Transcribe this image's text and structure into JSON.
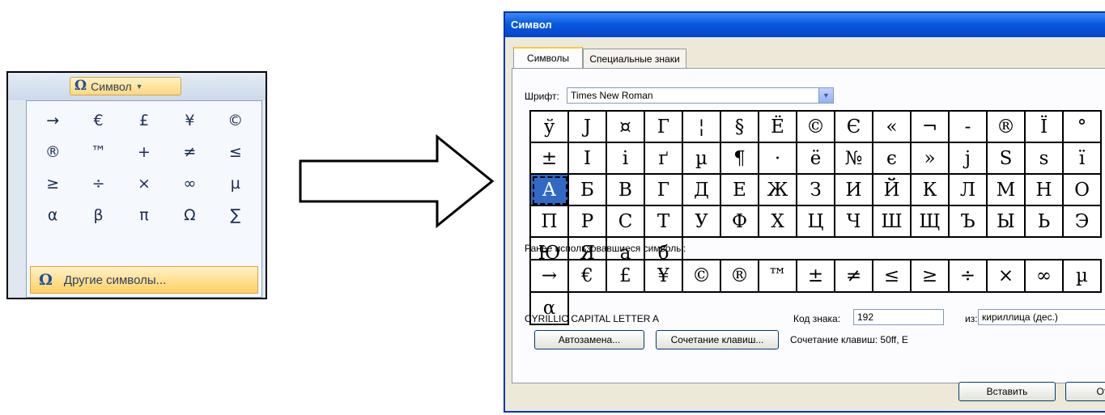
{
  "dropdown": {
    "button_label": "Символ",
    "symbols": [
      "→",
      "€",
      "£",
      "¥",
      "©",
      "®",
      "™",
      "+",
      "≠",
      "≤",
      "≥",
      "÷",
      "×",
      "∞",
      "µ",
      "α",
      "β",
      "π",
      "Ω",
      "∑"
    ],
    "other_symbols_label": "Другие символы..."
  },
  "dialog": {
    "title": "Символ",
    "tabs": [
      "Символы",
      "Специальные знаки"
    ],
    "font_label": "Шрифт:",
    "font_value": "Times New Roman",
    "grid_rows": [
      [
        "ў",
        "J",
        "¤",
        "Г",
        "¦",
        "§",
        "Ё",
        "©",
        "Є",
        "«",
        "¬",
        "-",
        "®",
        "Ї",
        "°",
        "±"
      ],
      [
        "I",
        "і",
        "ґ",
        "µ",
        "¶",
        "·",
        "ё",
        "№",
        "є",
        "»",
        "j",
        "S",
        "s",
        "ї",
        "А",
        "Б"
      ],
      [
        "В",
        "Г",
        "Д",
        "Е",
        "Ж",
        "З",
        "И",
        "Й",
        "К",
        "Л",
        "М",
        "Н",
        "О",
        "П",
        "Р",
        "С"
      ],
      [
        "Т",
        "У",
        "Ф",
        "Х",
        "Ц",
        "Ч",
        "Ш",
        "Щ",
        "Ъ",
        "Ы",
        "Ь",
        "Э",
        "Ю",
        "Я",
        "а",
        "б"
      ]
    ],
    "selected_char": "А",
    "recent_label": "Ранее использовавшиеся символы:",
    "recent": [
      "→",
      "€",
      "£",
      "¥",
      "©",
      "®",
      "™",
      "±",
      "≠",
      "≤",
      "≥",
      "÷",
      "×",
      "∞",
      "µ",
      "α"
    ],
    "char_name": "CYRILLIC CAPITAL LETTER A",
    "code_label": "Код знака:",
    "code_value": "192",
    "from_label": "из:",
    "encoding_value": "кириллица (дес.)",
    "autocorrect_label": "Автозамена...",
    "shortcut_button_label": "Сочетание клавиш...",
    "shortcut_text": "Сочетание клавиш: 50ff, E",
    "insert_label": "Вставить",
    "cancel_label": "Отмена"
  }
}
